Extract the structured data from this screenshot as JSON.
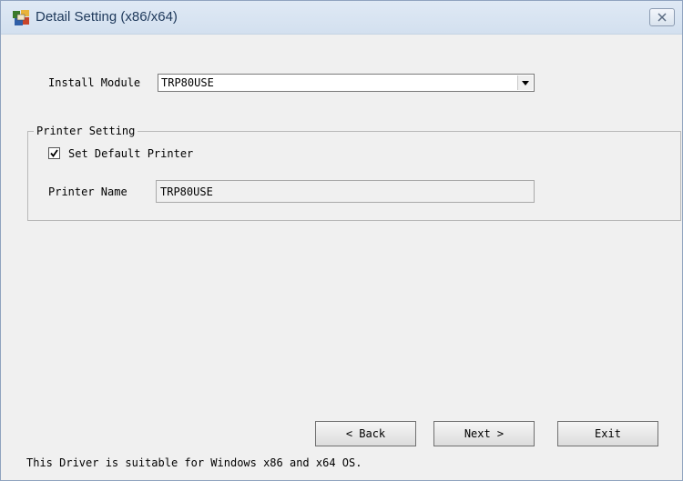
{
  "window": {
    "title": "Detail Setting (x86/x64)",
    "icon": "printer-app-icon",
    "close_icon": "close-icon"
  },
  "install_module": {
    "label": "Install Module",
    "selected": "TRP80USE"
  },
  "printer_setting": {
    "group_title": "Printer Setting",
    "set_default_label": "Set Default Printer",
    "set_default_checked": true,
    "printer_name_label": "Printer Name",
    "printer_name_value": "TRP80USE"
  },
  "buttons": {
    "back": "< Back",
    "next": "Next >",
    "exit": "Exit"
  },
  "footer_text": "This Driver is suitable for Windows x86 and x64 OS."
}
